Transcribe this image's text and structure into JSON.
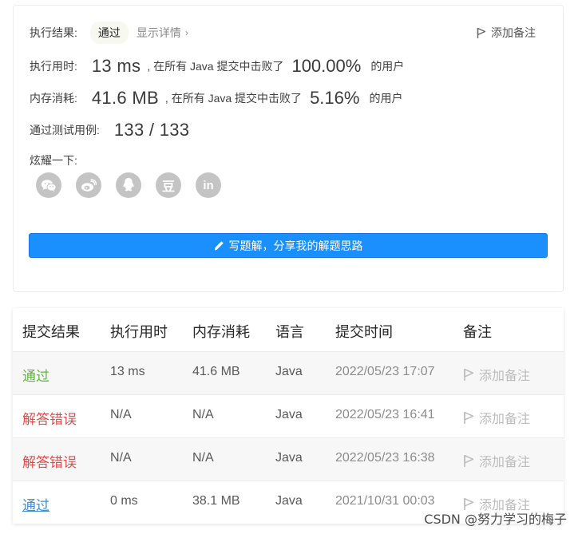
{
  "result": {
    "label": "执行结果:",
    "status": "通过",
    "details_link": "显示详情",
    "add_note": "添加备注",
    "runtime": {
      "label": "执行用时:",
      "value": "13 ms",
      "prefix": ", 在所有 Java 提交中击败了",
      "percent": "100.00%",
      "suffix": "的用户"
    },
    "memory": {
      "label": "内存消耗:",
      "value": "41.6 MB",
      "prefix": ", 在所有 Java 提交中击败了",
      "percent": "5.16%",
      "suffix": "的用户"
    },
    "tests": {
      "label": "通过测试用例:",
      "value": "133 / 133"
    },
    "share": {
      "label": "炫耀一下:",
      "icons": [
        "wechat-icon",
        "weibo-icon",
        "qq-icon",
        "douban-icon",
        "linkedin-icon"
      ],
      "douban_glyph": "豆",
      "linkedin_glyph": "in"
    },
    "write_button": "写题解，分享我的解题思路"
  },
  "submissions": {
    "columns": [
      "提交结果",
      "执行用时",
      "内存消耗",
      "语言",
      "提交时间",
      "备注"
    ],
    "rows": [
      {
        "status": "通过",
        "runtime": "13 ms",
        "memory": "41.6 MB",
        "lang": "Java",
        "time": "2022/05/23 17:07",
        "note": "添加备注"
      },
      {
        "status": "解答错误",
        "runtime": "N/A",
        "memory": "N/A",
        "lang": "Java",
        "time": "2022/05/23 16:41",
        "note": "添加备注"
      },
      {
        "status": "解答错误",
        "runtime": "N/A",
        "memory": "N/A",
        "lang": "Java",
        "time": "2022/05/23 16:38",
        "note": "添加备注"
      },
      {
        "status": "通过",
        "runtime": "0 ms",
        "memory": "38.1 MB",
        "lang": "Java",
        "time": "2021/10/31 00:03",
        "note": "添加备注"
      }
    ]
  },
  "watermark": "CSDN @努力学习的梅子",
  "colors": {
    "accent": "#1a90ff",
    "accepted": "#5cb83a",
    "wrong_answer": "#e34b4b",
    "link": "#3d8fd6"
  }
}
